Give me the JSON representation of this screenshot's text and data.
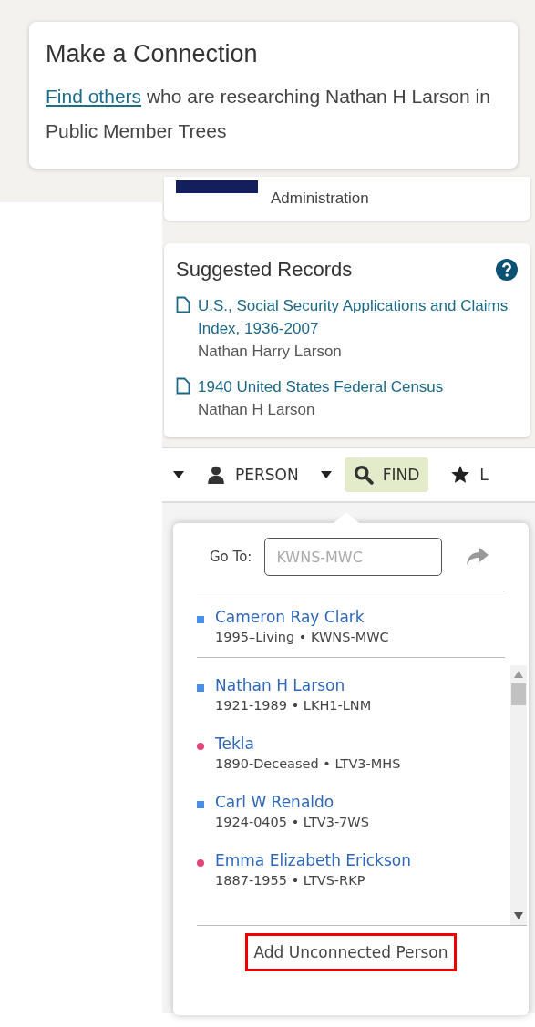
{
  "connection_card": {
    "title": "Make a Connection",
    "link": "Find others",
    "text": "who are researching Nathan H Larson in Public Member Trees"
  },
  "previous_card": {
    "text": "Administration"
  },
  "suggested_records": {
    "title": "Suggested Records",
    "records": [
      {
        "title": "U.S., Social Security Applications and Claims Index, 1936-2007",
        "name": "Nathan Harry Larson"
      },
      {
        "title": "1940 United States Federal Census",
        "name": "Nathan H Larson"
      }
    ]
  },
  "toolbar": {
    "items": [
      {
        "kind": "caret"
      },
      {
        "kind": "person",
        "label": "PERSON",
        "selected": false
      },
      {
        "kind": "caret"
      },
      {
        "kind": "find",
        "label": "FIND",
        "selected": true
      },
      {
        "kind": "star",
        "label": "L",
        "selected": false
      }
    ]
  },
  "find_popup": {
    "goto_label": "Go To:",
    "goto_placeholder": "KWNS-MWC",
    "current": {
      "name": "Cameron Ray Clark",
      "details": "1995–Living • KWNS-MWC",
      "kind": "male"
    },
    "people": [
      {
        "name": "Nathan H Larson",
        "details": "1921-1989 • LKH1-LNM",
        "kind": "male"
      },
      {
        "name": "Tekla",
        "details": "1890-Deceased • LTV3-MHS",
        "kind": "female"
      },
      {
        "name": "Carl W Renaldo",
        "details": "1924-0405 • LTV3-7WS",
        "kind": "male"
      },
      {
        "name": "Emma Elizabeth Erickson",
        "details": "1887-1955 • LTVS-RKP",
        "kind": "female"
      }
    ],
    "add_button": {
      "label": "Add Unconnected Person",
      "highlighted": true
    }
  }
}
